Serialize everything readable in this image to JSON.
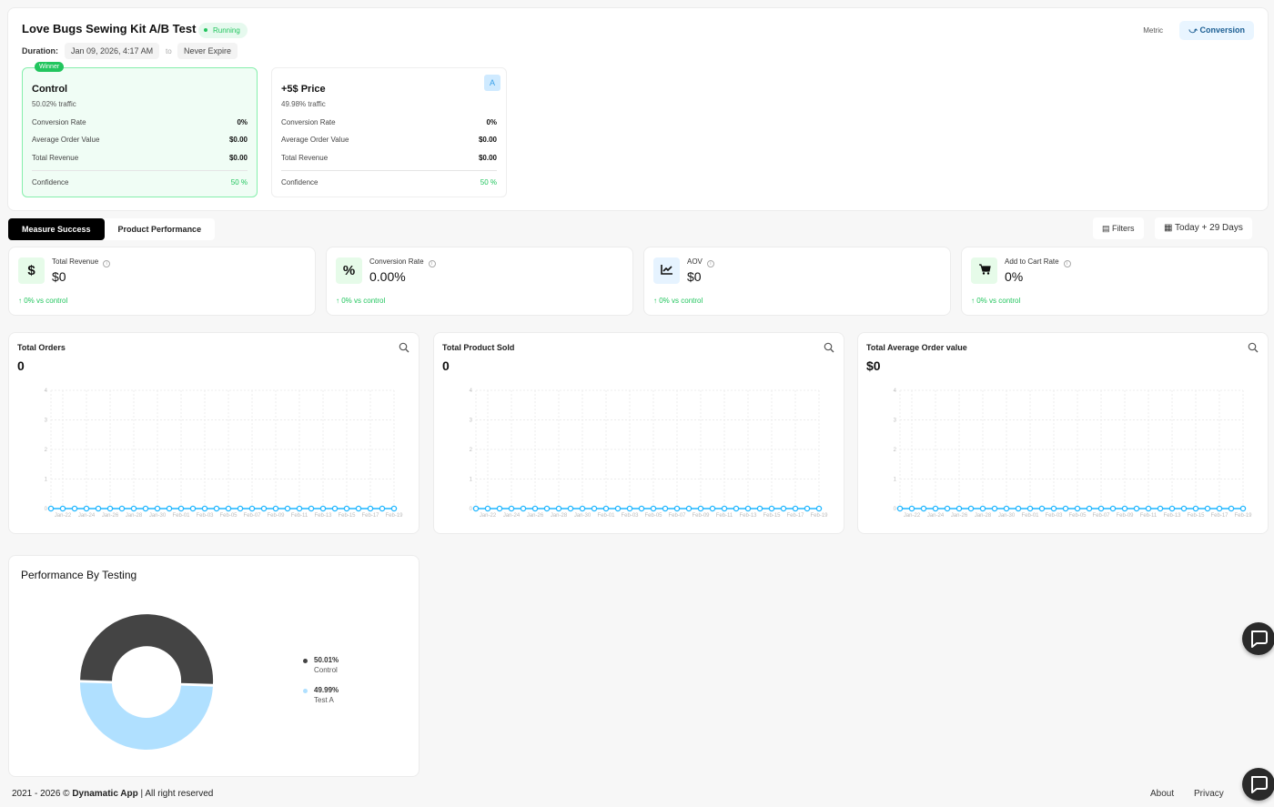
{
  "header": {
    "title": "Love Bugs Sewing Kit A/B Test",
    "status": "Running",
    "duration_label": "Duration:",
    "start": "Jan 09, 2026, 4:17 AM",
    "to": "to",
    "end": "Never Expire",
    "metric_label": "Metric",
    "metric_value": "Conversion"
  },
  "variants": [
    {
      "name": "Control",
      "badge": "Winner",
      "traffic": "50.02% traffic",
      "rows": [
        {
          "label": "Conversion Rate",
          "value": "0%"
        },
        {
          "label": "Average Order Value",
          "value": "$0.00"
        },
        {
          "label": "Total Revenue",
          "value": "$0.00"
        }
      ],
      "confidence_label": "Confidence",
      "confidence": "50 %"
    },
    {
      "name": "+5$ Price",
      "badge": "A",
      "traffic": "49.98% traffic",
      "rows": [
        {
          "label": "Conversion Rate",
          "value": "0%"
        },
        {
          "label": "Average Order Value",
          "value": "$0.00"
        },
        {
          "label": "Total Revenue",
          "value": "$0.00"
        }
      ],
      "confidence_label": "Confidence",
      "confidence": "50 %"
    }
  ],
  "tabs": [
    "Measure Success",
    "Product Performance"
  ],
  "toolbar": {
    "filters": "Filters",
    "range": "Today + 29 Days"
  },
  "metrics": [
    {
      "label": "Total Revenue",
      "value": "$0",
      "delta": "0% vs control",
      "icon": "$",
      "bg": "#e6fbe9"
    },
    {
      "label": "Conversion Rate",
      "value": "0.00%",
      "delta": "0% vs control",
      "icon": "%",
      "bg": "#e6fbe9"
    },
    {
      "label": "AOV",
      "value": "$0",
      "delta": "0% vs control",
      "icon": "chart",
      "bg": "#e6f3ff"
    },
    {
      "label": "Add to Cart Rate",
      "value": "0%",
      "delta": "0% vs control",
      "icon": "cart",
      "bg": "#e6fbe9"
    }
  ],
  "chart_data": [
    {
      "type": "line",
      "title": "Total Orders",
      "total": "0",
      "yticks": [
        "0",
        "1",
        "2",
        "3",
        "4"
      ],
      "ylim": [
        0,
        4
      ],
      "xticks": [
        "Jan-22",
        "Jan-24",
        "Jan-26",
        "Jan-28",
        "Jan-30",
        "Feb-01",
        "Feb-03",
        "Feb-05",
        "Feb-07",
        "Feb-09",
        "Feb-11",
        "Feb-13",
        "Feb-15",
        "Feb-17",
        "Feb-19"
      ],
      "values": [
        0,
        0,
        0,
        0,
        0,
        0,
        0,
        0,
        0,
        0,
        0,
        0,
        0,
        0,
        0,
        0,
        0,
        0,
        0,
        0,
        0,
        0,
        0,
        0,
        0,
        0,
        0,
        0,
        0,
        0
      ],
      "color": "#1fb6ff"
    },
    {
      "type": "line",
      "title": "Total Product Sold",
      "total": "0",
      "yticks": [
        "0",
        "1",
        "2",
        "3",
        "4"
      ],
      "ylim": [
        0,
        4
      ],
      "xticks": [
        "Jan-22",
        "Jan-24",
        "Jan-26",
        "Jan-28",
        "Jan-30",
        "Feb-01",
        "Feb-03",
        "Feb-05",
        "Feb-07",
        "Feb-09",
        "Feb-11",
        "Feb-13",
        "Feb-15",
        "Feb-17",
        "Feb-19"
      ],
      "values": [
        0,
        0,
        0,
        0,
        0,
        0,
        0,
        0,
        0,
        0,
        0,
        0,
        0,
        0,
        0,
        0,
        0,
        0,
        0,
        0,
        0,
        0,
        0,
        0,
        0,
        0,
        0,
        0,
        0,
        0
      ],
      "color": "#1fb6ff"
    },
    {
      "type": "line",
      "title": "Total Average Order value",
      "total": "$0",
      "yticks": [
        "0",
        "1",
        "2",
        "3",
        "4"
      ],
      "ylim": [
        0,
        4
      ],
      "xticks": [
        "Jan-22",
        "Jan-24",
        "Jan-26",
        "Jan-28",
        "Jan-30",
        "Feb-01",
        "Feb-03",
        "Feb-05",
        "Feb-07",
        "Feb-09",
        "Feb-11",
        "Feb-13",
        "Feb-15",
        "Feb-17",
        "Feb-19"
      ],
      "values": [
        0,
        0,
        0,
        0,
        0,
        0,
        0,
        0,
        0,
        0,
        0,
        0,
        0,
        0,
        0,
        0,
        0,
        0,
        0,
        0,
        0,
        0,
        0,
        0,
        0,
        0,
        0,
        0,
        0,
        0
      ],
      "color": "#1fb6ff"
    },
    {
      "type": "pie",
      "title": "Performance By Testing",
      "slices": [
        {
          "label": "Control",
          "value": 50.01,
          "text": "50.01%",
          "color": "#444444"
        },
        {
          "label": "Test A",
          "value": 49.99,
          "text": "49.99%",
          "color": "#b0e0ff"
        }
      ]
    }
  ],
  "footer": {
    "years": "2021 - 2026 ©",
    "brand": "Dynamatic App",
    "rights": "All right reserved",
    "links": [
      "About",
      "Privacy"
    ]
  }
}
